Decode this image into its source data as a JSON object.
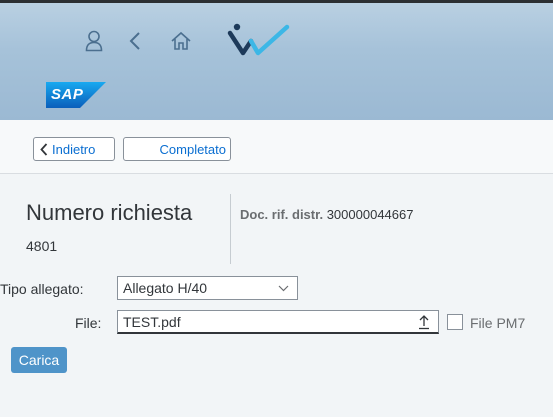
{
  "shell": {
    "icons": [
      "user-icon",
      "back-icon",
      "home-icon"
    ],
    "logo_text": "SAP"
  },
  "toolbar": {
    "back_label": "Indietro",
    "done_label": "Completato"
  },
  "header": {
    "title": "Numero richiesta",
    "number": "4801",
    "doc_ref_label": "Doc. rif. distr.",
    "doc_ref_value": "300000044667"
  },
  "form": {
    "attachment_type_label": "Tipo allegato:",
    "attachment_type_value": "Allegato H/40",
    "file_label": "File:",
    "file_value": "TEST.pdf",
    "pm7_label": "File PM7",
    "upload_label": "Carica"
  },
  "colors": {
    "accent": "#0a6ed1",
    "shell_bg": "#a6c2d9",
    "upload_btn": "#4f94c9"
  }
}
